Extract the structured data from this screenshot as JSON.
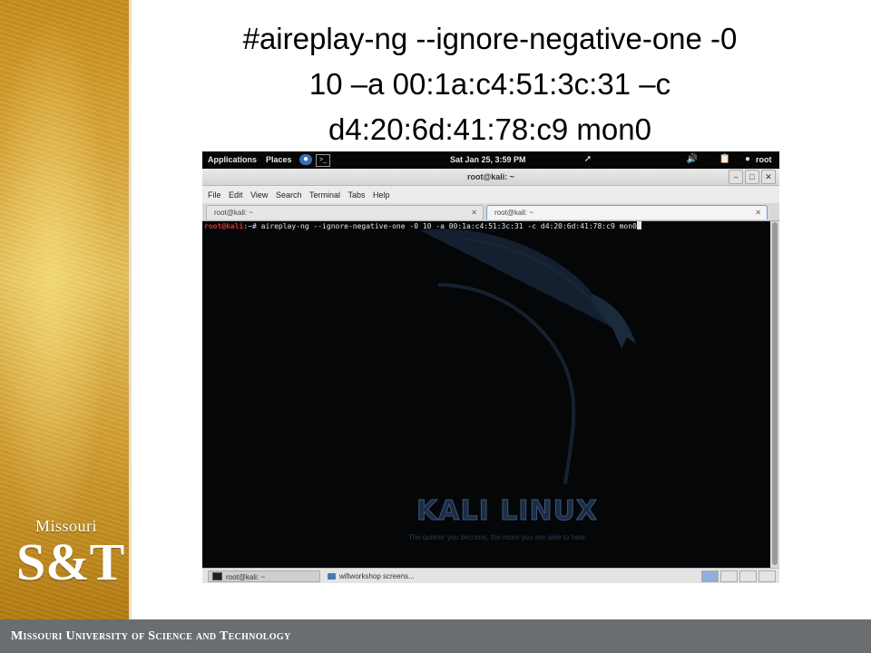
{
  "slide": {
    "title_lines": [
      "#aireplay-ng --ignore-negative-one -0",
      "10 –a 00:1a:c4:51:3c:31 –c",
      "d4:20:6d:41:78:c9 mon0"
    ],
    "logo_top": "Missouri",
    "logo_main": "S&T",
    "footer": "Missouri University of Science and Technology"
  },
  "screen": {
    "topbar": {
      "applications": "Applications",
      "places": "Places",
      "datetime": "Sat Jan 25,  3:59 PM",
      "user": "root"
    },
    "window_title": "root@kali: ~",
    "window_buttons": {
      "minimize": "–",
      "maximize": "□",
      "close": "✕"
    },
    "menu": [
      "File",
      "Edit",
      "View",
      "Search",
      "Terminal",
      "Tabs",
      "Help"
    ],
    "tabs": [
      {
        "label": "root@kali: ~",
        "close": "✕"
      },
      {
        "label": "root@kali: ~",
        "close": "✕"
      }
    ],
    "terminal": {
      "prompt_user": "root@kali",
      "prompt_rest": ":~# ",
      "command": "aireplay-ng --ignore-negative-one -0 10 -a 00:1a:c4:51:3c:31 -c d4:20:6d:41:78:c9 mon0",
      "wallpaper_logo": "KALI LINUX",
      "wallpaper_tagline": "The quieter you become, the more you are able to hear."
    },
    "taskbar": {
      "items": [
        "root@kali: ~",
        "wifiworkshop screens..."
      ]
    },
    "colors": {
      "prompt": "#e0302a",
      "terminal_bg": "#050608",
      "active_tab_border": "#6d9ad1"
    }
  }
}
